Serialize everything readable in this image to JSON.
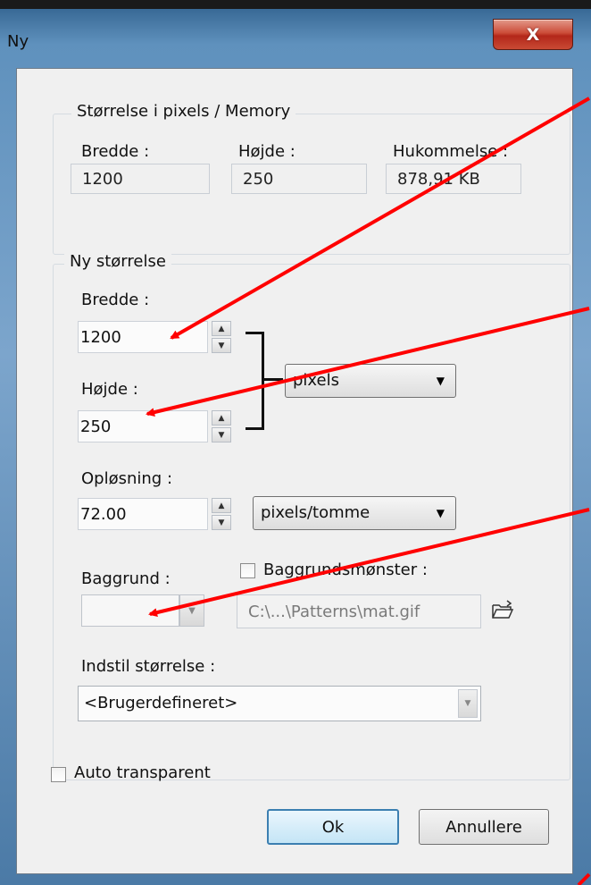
{
  "window": {
    "title": "Ny",
    "close_glyph": "X"
  },
  "size_memory": {
    "legend": "Størrelse i pixels / Memory",
    "width_label": "Bredde :",
    "width_value": "1200",
    "height_label": "Højde :",
    "height_value": "250",
    "memory_label": "Hukommelse :",
    "memory_value": "878,91 KB"
  },
  "new_size": {
    "legend": "Ny størrelse",
    "width_label": "Bredde :",
    "width_value": "1200",
    "height_label": "Højde :",
    "height_value": "250",
    "size_unit": "pixels",
    "resolution_label": "Opløsning :",
    "resolution_value": "72.00",
    "resolution_unit": "pixels/tomme",
    "background_label": "Baggrund :",
    "pattern_label": "Baggrundsmønster :",
    "pattern_path": "C:\\...\\Patterns\\mat.gif",
    "preset_label": "Indstil størrelse :",
    "preset_value": "<Brugerdefineret>"
  },
  "auto_transparent_label": "Auto transparent",
  "buttons": {
    "ok": "Ok",
    "cancel": "Annullere"
  },
  "colors": {
    "annotation_arrow": "#ff0000",
    "close_button": "#c9412e",
    "default_button_border": "#3c7fb1"
  },
  "icons": {
    "spin_up": "▲",
    "spin_down": "▼",
    "dropdown": "▼",
    "folder": "folder-open-icon"
  }
}
